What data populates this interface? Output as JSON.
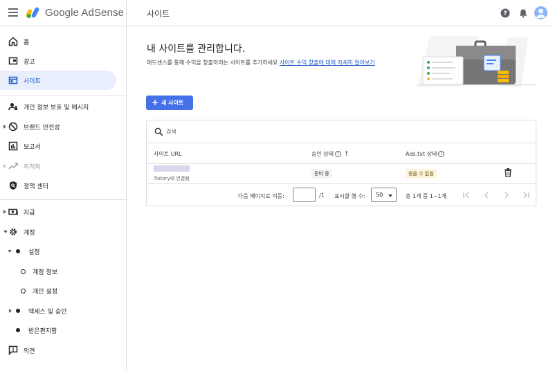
{
  "header": {
    "brand": "Google AdSense",
    "title": "사이트"
  },
  "sidebar": {
    "items": [
      {
        "label": "홈",
        "icon": "home-icon"
      },
      {
        "label": "광고",
        "icon": "ads-icon"
      },
      {
        "label": "사이트",
        "icon": "sites-icon",
        "active": true
      },
      {
        "label": "개인 정보 보호 및 메시지",
        "icon": "privacy-icon"
      },
      {
        "label": "브랜드 안전성",
        "icon": "block-icon"
      },
      {
        "label": "보고서",
        "icon": "report-icon"
      },
      {
        "label": "최적화",
        "icon": "trending-icon",
        "disabled": true
      },
      {
        "label": "정책 센터",
        "icon": "policy-icon"
      },
      {
        "label": "지급",
        "icon": "payments-icon"
      },
      {
        "label": "계정",
        "icon": "gear-icon"
      },
      {
        "label": "설정"
      },
      {
        "label": "계정 정보"
      },
      {
        "label": "개인 설정"
      },
      {
        "label": "액세스 및 승인"
      },
      {
        "label": "받은편지함"
      },
      {
        "label": "의견",
        "icon": "feedback-icon"
      }
    ]
  },
  "main": {
    "title": "내 사이트를 관리합니다.",
    "subtitle": "애드센스를 통해 수익을 창출하려는 사이트를 추가하세요",
    "subtitle_link": "사이트 수익 창출에 대해 자세히 알아보기",
    "new_site_button": "새 사이트"
  },
  "table": {
    "search_placeholder": "검색",
    "columns": {
      "url": "사이트 URL",
      "approval": "승인 상태",
      "ads_txt": "Ads.txt 상태"
    },
    "rows": [
      {
        "connected": "Tistory에 연결됨",
        "approval": "준비 중",
        "ads_txt": "찾을 수 없음"
      }
    ],
    "pager": {
      "go_to_page": "다음 페이지로 이동:",
      "page_value": "",
      "total_pages": "/1",
      "rows_per_page": "표시할 행 수:",
      "rows_value": "50",
      "range": "총 1개 중 1~1개"
    }
  },
  "colors": {
    "accent": "#4470e8",
    "active_bg": "#e8eefc"
  }
}
